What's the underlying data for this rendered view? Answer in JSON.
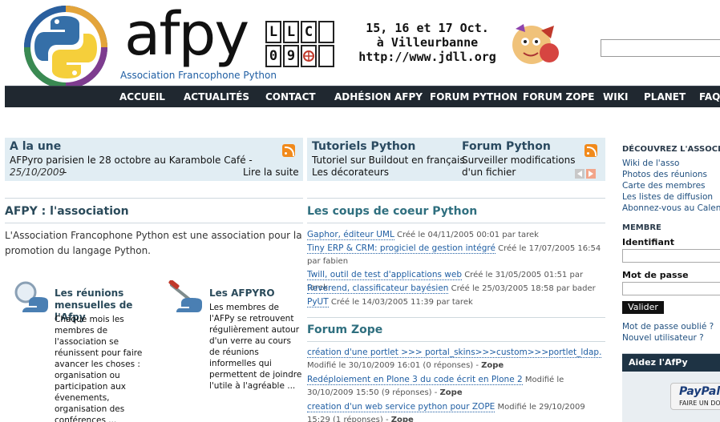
{
  "header": {
    "logo_text": "afpy",
    "logo_subtitle": "Association Francophone Python",
    "banner": {
      "grid": [
        "L",
        "L",
        "C",
        "",
        "0",
        "9",
        "",
        ""
      ],
      "line1": "15, 16 et 17 Oct.",
      "line2": "à Villeurbanne",
      "line3": "http://www.jdll.org"
    },
    "search_placeholder": ""
  },
  "nav": {
    "items": [
      "ACCUEIL",
      "ACTUALITÉS",
      "CONTACT",
      "ADHÉSION AFPY",
      "FORUM PYTHON",
      "FORUM ZOPE",
      "WIKI",
      "PLANET",
      "FAQ"
    ]
  },
  "featured": {
    "une": {
      "title": "A la une",
      "text": "AFPyro parisien le 28 octobre au Karambole Café -",
      "date": "25/10/2009",
      "sep": "-",
      "more": "Lire la suite"
    },
    "tutoriels": {
      "title": "Tutoriels Python",
      "items": [
        "Tutoriel sur Buildout en français",
        "Les décorateurs"
      ]
    },
    "forum": {
      "title": "Forum Python",
      "items": [
        "Surveiller modifications",
        "d'un fichier"
      ]
    }
  },
  "association": {
    "title": "AFPY : l'association",
    "intro": "L'Association Francophone Python est une association pour la promotion du langage Python.",
    "reunions": {
      "title": "Les réunions mensuelles de l'Afpy",
      "text": "Chaque mois les membres de l'association se réunissent pour faire avancer les choses : organisation ou participation aux évenements, organisation des conférences ..."
    },
    "afpyro": {
      "title": "Les AFPYRO",
      "text": "Les membres de l'AFPy se retrouvent régulièrement autour d'un verre au cours de réunions informelles qui permettent de joindre l'utile à l'agréable ..."
    }
  },
  "coups_de_coeur": {
    "title": "Les coups de coeur Python",
    "entries": [
      {
        "link": "Gaphor, éditeur UML",
        "meta": " Créé le 04/11/2005 00:01 par tarek"
      },
      {
        "link": "Tiny ERP & CRM: progiciel de gestion intégré",
        "meta": " Créé le 17/07/2005 16:54 par fabien"
      },
      {
        "link": "Twill, outil de test d'applications web",
        "meta": " Créé le 31/05/2005 01:51 par tarek"
      },
      {
        "link": "Reverend, classificateur bayésien",
        "meta": " Créé le 25/03/2005 18:58 par bader"
      },
      {
        "link": "PyUT",
        "meta": " Créé le 14/03/2005 11:39 par tarek"
      }
    ]
  },
  "forum_zope": {
    "title": "Forum Zope",
    "entries": [
      {
        "link": "création d'une portlet >>> portal_skins>>>custom>>>portlet_ldap.",
        "meta": " Modifié le 30/10/2009 16:01 (0 réponses) - ",
        "tag": "Zope"
      },
      {
        "link": "Redéploiement en Plone 3 du code écrit en Plone 2",
        "meta": " Modifié le 30/10/2009 15:50 (9 réponses) - ",
        "tag": "Zope"
      },
      {
        "link": "creation d'un web service python pour ZOPE",
        "meta": " Modifié le 29/10/2009 15:29 (1 réponses) - ",
        "tag": "Zope"
      }
    ]
  },
  "sidebar": {
    "discover_title": "DÉCOUVREZ L'ASSOCIATION",
    "links": [
      "Wiki de l'asso",
      "Photos des réunions",
      "Carte des membres",
      "Les listes de diffusion",
      "Abonnez-vous au Calendrier"
    ],
    "member_title": "MEMBRE",
    "login_label": "Identifiant",
    "password_label": "Mot de passe",
    "login_button": "Valider",
    "forgot": "Mot de passe oublié ?",
    "new_user": "Nouvel utilisateur ?",
    "donate_title": "Aidez l'AfPy",
    "paypal_text": "PayPal",
    "paypal_sub": "FAIRE UN DON"
  },
  "colors": {
    "nav_bg": "#202830",
    "featured_bg": "#e1edf3",
    "link": "#1f5ea3",
    "rss": "#f18a1b"
  }
}
